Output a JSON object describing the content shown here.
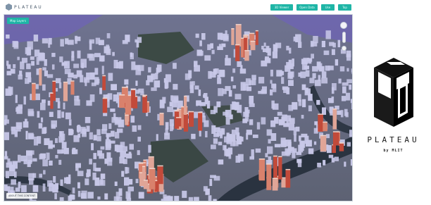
{
  "app": {
    "logo_text": "PLATEAU"
  },
  "toolbar": {
    "buttons": [
      {
        "label": "3D Viewer"
      },
      {
        "label": "Open Data"
      },
      {
        "label": "Use"
      },
      {
        "label": "Top"
      }
    ]
  },
  "map": {
    "layer_chip": "Map Layers",
    "attribution": "ABOUT THIS CONTENT"
  },
  "brand": {
    "name": "PLATEAU",
    "subtitle": "by MLIT"
  },
  "colors": {
    "accent": "#1fb5a6",
    "building_default": "#c8c8e8",
    "building_highlight": "#d9816c",
    "water": "#2a3340",
    "park": "#3c4a45"
  }
}
